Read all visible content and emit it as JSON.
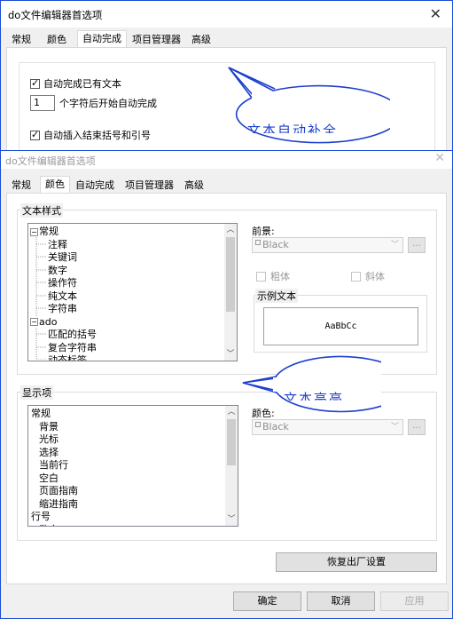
{
  "back_dialog": {
    "title": "do文件编辑器首选项",
    "tabs": [
      "常规",
      "颜色",
      "自动完成",
      "项目管理器",
      "高级"
    ],
    "active_tab": 2,
    "options": {
      "autocomplete_text": "自动完成已有文本",
      "chars_value": "1",
      "chars_suffix": "个字符后开始自动完成",
      "insert_brackets": "自动插入结束括号和引号"
    }
  },
  "callouts": {
    "top_text": "文本自动补全",
    "mid_text": "文本高亮",
    "color": "#1c3fcf"
  },
  "front_dialog": {
    "title": "do文件编辑器首选项",
    "tabs": [
      "常规",
      "颜色",
      "自动完成",
      "项目管理器",
      "高级"
    ],
    "active_tab": 1,
    "text_style_group": {
      "title": "文本样式",
      "tree": [
        {
          "label": "常规",
          "level": 0,
          "expander": "−"
        },
        {
          "label": "注释",
          "level": 1
        },
        {
          "label": "关键词",
          "level": 1
        },
        {
          "label": "数字",
          "level": 1
        },
        {
          "label": "操作符",
          "level": 1
        },
        {
          "label": "纯文本",
          "level": 1
        },
        {
          "label": "字符串",
          "level": 1
        },
        {
          "label": "ado",
          "level": 0,
          "expander": "−"
        },
        {
          "label": "匹配的括号",
          "level": 1
        },
        {
          "label": "复合字符串",
          "level": 1
        },
        {
          "label": "动态标签",
          "level": 1
        }
      ],
      "foreground_label": "前景:",
      "foreground_value": "Black",
      "bold_label": "粗体",
      "italic_label": "斜体",
      "sample_group_title": "示例文本",
      "sample_text": "AaBbCc",
      "more_button": "..."
    },
    "display_group": {
      "title": "显示项",
      "list": [
        {
          "label": "常规",
          "level": 0
        },
        {
          "label": "背景",
          "level": 1
        },
        {
          "label": "光标",
          "level": 1
        },
        {
          "label": "选择",
          "level": 1
        },
        {
          "label": "当前行",
          "level": 1
        },
        {
          "label": "空白",
          "level": 1
        },
        {
          "label": "页面指南",
          "level": 1
        },
        {
          "label": "缩进指南",
          "level": 1
        },
        {
          "label": "行号",
          "level": 0
        },
        {
          "label": "数字",
          "level": 1
        }
      ],
      "color_label": "颜色:",
      "color_value": "Black",
      "more_button": "..."
    },
    "restore_button": "恢复出厂设置",
    "ok_button": "确定",
    "cancel_button": "取消",
    "apply_button": "应用"
  }
}
